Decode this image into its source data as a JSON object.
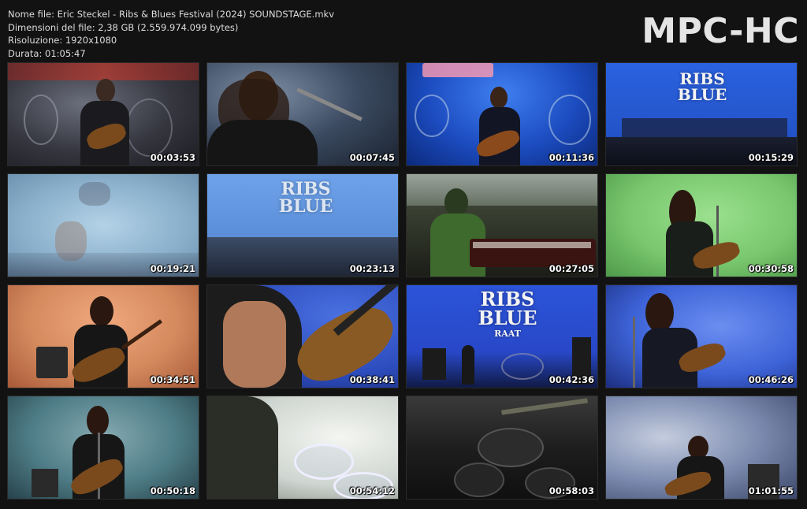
{
  "file_info": {
    "name": "Nome file: Eric Steckel - Ribs & Blues Festival (2024) SOUNDSTAGE.mkv",
    "size": "Dimensioni del file: 2,38 GB (2.559.974.099 bytes)",
    "resolution": "Risoluzione: 1920x1080",
    "duration": "Durata: 01:05:47"
  },
  "logo": "MPC-HC",
  "stage_signs": {
    "ribs": "RIBS",
    "blue": "BLUE",
    "sub": "RAAT"
  },
  "thumbnails": [
    {
      "time": "00:03:53",
      "bg": "#3b3b45"
    },
    {
      "time": "00:07:45",
      "bg": "#3a4a60"
    },
    {
      "time": "00:11:36",
      "bg": "#1d4fc0"
    },
    {
      "time": "00:15:29",
      "bg": "#2b5fd8"
    },
    {
      "time": "00:19:21",
      "bg": "#8fb4d0"
    },
    {
      "time": "00:23:13",
      "bg": "#5d8fd8"
    },
    {
      "time": "00:27:05",
      "bg": "#3e4a3a"
    },
    {
      "time": "00:30:58",
      "bg": "#79c76e"
    },
    {
      "time": "00:34:51",
      "bg": "#d58a5e"
    },
    {
      "time": "00:38:41",
      "bg": "#2e4ec0"
    },
    {
      "time": "00:42:36",
      "bg": "#2848c8"
    },
    {
      "time": "00:46:26",
      "bg": "#3d63d8"
    },
    {
      "time": "00:50:18",
      "bg": "#4e7c86"
    },
    {
      "time": "00:54:12",
      "bg": "#cfd5d0"
    },
    {
      "time": "00:58:03",
      "bg": "#222222"
    },
    {
      "time": "01:01:55",
      "bg": "#5d6e98"
    }
  ]
}
